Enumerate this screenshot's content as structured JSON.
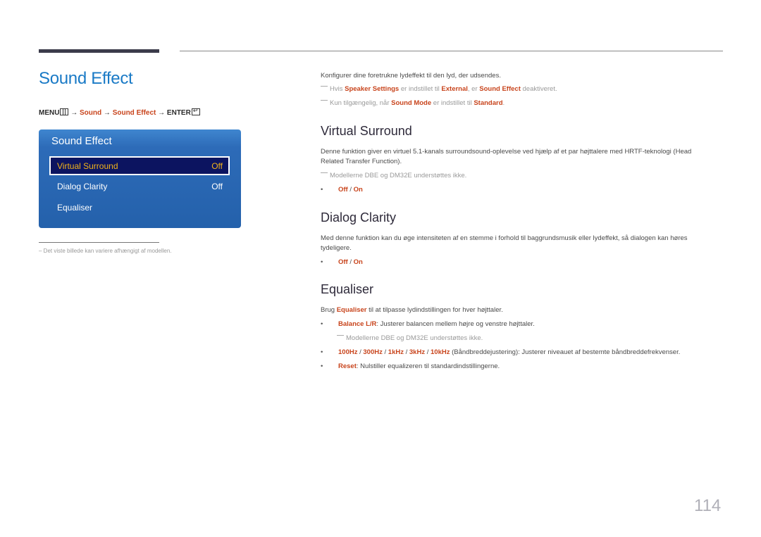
{
  "header": {
    "title": "Sound Effect"
  },
  "menu_path": {
    "menu": "MENU",
    "menu_icon": "menu-grid-icon",
    "arrow": "→",
    "step1": "Sound",
    "step2": "Sound Effect",
    "enter": "ENTER",
    "enter_icon": "enter-icon"
  },
  "osd": {
    "title": "Sound Effect",
    "items": [
      {
        "label": "Virtual Surround",
        "value": "Off",
        "selected": true
      },
      {
        "label": "Dialog Clarity",
        "value": "Off",
        "selected": false
      },
      {
        "label": "Equaliser",
        "value": "",
        "selected": false
      }
    ]
  },
  "footnote": "–  Det viste billede kan variere afhængigt af modellen.",
  "intro": {
    "text": "Konfigurer dine foretrukne lydeffekt til den lyd, der udsendes.",
    "note1": {
      "a": "Hvis ",
      "b": "Speaker Settings",
      "c": " er indstillet til ",
      "d": "External",
      "e": ", er ",
      "f": "Sound Effect",
      "g": " deaktiveret."
    },
    "note2": {
      "a": "Kun tilgængelig, når ",
      "b": "Sound Mode",
      "c": " er indstillet til ",
      "d": "Standard",
      "e": "."
    }
  },
  "sections": {
    "virtual_surround": {
      "heading": "Virtual Surround",
      "line1": "Denne funktion giver en virtuel 5.1-kanals surroundsound-oplevelse ved hjælp af et par højttalere med HRTF-teknologi (Head",
      "line2": "Related Transfer Function).",
      "note": "Modellerne DBE og DM32E understøttes ikke.",
      "opt_off": "Off",
      "sep": " / ",
      "opt_on": "On"
    },
    "dialog_clarity": {
      "heading": "Dialog Clarity",
      "line1": "Med denne funktion kan du øge intensiteten af en stemme i forhold til baggrundsmusik eller lydeffekt, så dialogen kan høres",
      "line2": "tydeligere.",
      "opt_off": "Off",
      "sep": " / ",
      "opt_on": "On"
    },
    "equaliser": {
      "heading": "Equaliser",
      "intro_a": "Brug ",
      "intro_b": "Equaliser",
      "intro_c": " til at tilpasse lydindstillingen for hver højttaler.",
      "balance_label": "Balance L/R",
      "balance_text": ": Justerer balancen mellem højre og venstre højttaler.",
      "balance_note": "Modellerne DBE og DM32E understøttes ikke.",
      "bands": [
        "100Hz",
        "300Hz",
        "1kHz",
        "3kHz",
        "10kHz"
      ],
      "band_sep": " / ",
      "bands_text": " (Båndbreddejustering): Justerer niveauet af bestemte båndbreddefrekvenser.",
      "reset_label": "Reset",
      "reset_text": ": Nulstiller equalizeren til standardindstillingerne."
    }
  },
  "page_number": "114",
  "bullet": "•"
}
